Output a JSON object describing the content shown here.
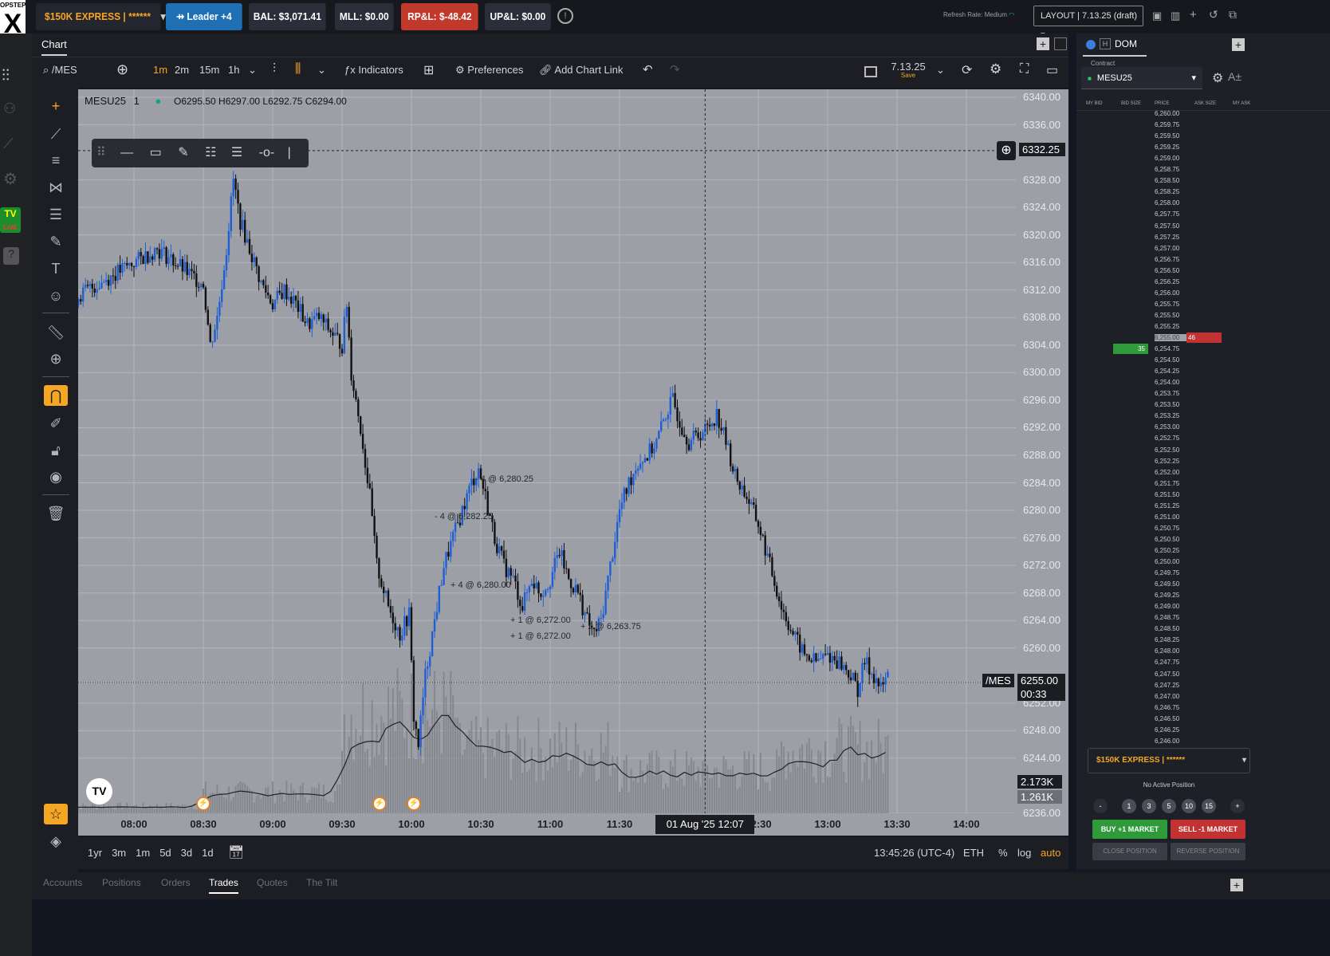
{
  "topbar": {
    "logo": "X",
    "logo_top": "OPSTEP",
    "account": "$150K EXPRESS | ******",
    "leader": "Leader +4",
    "bal": "BAL: $3,071.41",
    "mll": "MLL: $0.00",
    "rpl": "RP&L: $-48.42",
    "upl": "UP&L: $0.00",
    "refresh": "Refresh Rate: Medium",
    "layout": "LAYOUT | 7.13.25 (draft)"
  },
  "chart_header": {
    "tab": "Chart"
  },
  "toolbar": {
    "symbol": "/MES",
    "intervals": [
      "1m",
      "2m",
      "15m",
      "1h"
    ],
    "indicators": "Indicators",
    "preferences": "Preferences",
    "add_chart_link": "Add Chart Link",
    "layout_name": "7.13.25",
    "layout_state": "Save"
  },
  "legend": {
    "symbol": "MESU25",
    "interval": "1",
    "ohlc": "O6295.50  H6297.00  L6292.75  C6294.00"
  },
  "chart_data": {
    "type": "candlestick",
    "symbol": "MESU25",
    "interval": "1",
    "ylim": [
      6236,
      6340
    ],
    "y_ticks": [
      "6340.00",
      "6336.00",
      "6328.00",
      "6324.00",
      "6320.00",
      "6316.00",
      "6312.00",
      "6308.00",
      "6304.00",
      "6300.00",
      "6296.00",
      "6292.00",
      "6288.00",
      "6284.00",
      "6280.00",
      "6276.00",
      "6272.00",
      "6268.00",
      "6264.00",
      "6260.00",
      "6255.00",
      "6252.00",
      "6248.00",
      "6244.00",
      "6236.00"
    ],
    "x_ticks": [
      "08:00",
      "08:30",
      "09:00",
      "09:30",
      "10:00",
      "10:30",
      "11:00",
      "11:30",
      "12:30",
      "13:00",
      "13:30",
      "14:00"
    ],
    "x_minutes": [
      480,
      510,
      540,
      570,
      600,
      630,
      660,
      690,
      750,
      780,
      810,
      840
    ],
    "price_path": [
      [
        451,
        6310
      ],
      [
        460,
        6312
      ],
      [
        470,
        6314
      ],
      [
        480,
        6316
      ],
      [
        490,
        6318
      ],
      [
        498,
        6316
      ],
      [
        505,
        6314
      ],
      [
        510,
        6313
      ],
      [
        513,
        6304
      ],
      [
        516,
        6308
      ],
      [
        520,
        6318
      ],
      [
        523,
        6328
      ],
      [
        526,
        6322
      ],
      [
        530,
        6318
      ],
      [
        535,
        6313
      ],
      [
        540,
        6310
      ],
      [
        545,
        6312
      ],
      [
        550,
        6310
      ],
      [
        555,
        6307
      ],
      [
        560,
        6308
      ],
      [
        565,
        6306
      ],
      [
        570,
        6304
      ],
      [
        572,
        6310
      ],
      [
        574,
        6300
      ],
      [
        578,
        6292
      ],
      [
        582,
        6282
      ],
      [
        585,
        6272
      ],
      [
        590,
        6266
      ],
      [
        595,
        6262
      ],
      [
        599,
        6265
      ],
      [
        601,
        6250
      ],
      [
        603,
        6246
      ],
      [
        606,
        6256
      ],
      [
        610,
        6264
      ],
      [
        614,
        6272
      ],
      [
        618,
        6276
      ],
      [
        622,
        6280
      ],
      [
        626,
        6284
      ],
      [
        629,
        6286
      ],
      [
        632,
        6282
      ],
      [
        636,
        6276
      ],
      [
        640,
        6272
      ],
      [
        644,
        6270
      ],
      [
        648,
        6266
      ],
      [
        652,
        6270
      ],
      [
        656,
        6268
      ],
      [
        660,
        6270
      ],
      [
        664,
        6274
      ],
      [
        668,
        6270
      ],
      [
        672,
        6268
      ],
      [
        676,
        6264
      ],
      [
        679,
        6262
      ],
      [
        682,
        6264
      ],
      [
        686,
        6272
      ],
      [
        690,
        6280
      ],
      [
        694,
        6284
      ],
      [
        698,
        6287
      ],
      [
        702,
        6288
      ],
      [
        706,
        6290
      ],
      [
        710,
        6294
      ],
      [
        713,
        6296
      ],
      [
        716,
        6293
      ],
      [
        720,
        6290
      ],
      [
        724,
        6291
      ],
      [
        728,
        6292
      ],
      [
        732,
        6294
      ],
      [
        736,
        6290
      ],
      [
        740,
        6285
      ],
      [
        745,
        6282
      ],
      [
        750,
        6278
      ],
      [
        755,
        6272
      ],
      [
        760,
        6266
      ],
      [
        765,
        6262
      ],
      [
        770,
        6259
      ],
      [
        775,
        6258
      ],
      [
        780,
        6259
      ],
      [
        785,
        6258
      ],
      [
        790,
        6256
      ],
      [
        793,
        6254
      ],
      [
        796,
        6258
      ],
      [
        800,
        6256
      ],
      [
        803,
        6254
      ],
      [
        806,
        6256
      ]
    ],
    "last_price": "6255.00",
    "countdown": "00:33",
    "crosshair_price": "6332.25",
    "crosshair_time": "01 Aug '25  12:07",
    "volume_labels": [
      "2.173K",
      "1.261K"
    ],
    "annotations": [
      "- 4 @ 6,280.25",
      "- 4 @ 6,282.25",
      "+ 4 @ 6,280.00",
      "+ 1 @ 6,272.00",
      "+ 1 @ 6,272.00",
      "+ 2 @ 6,263.75"
    ],
    "price_badge_symbol": "/MES"
  },
  "bottombar": {
    "ranges": [
      "1yr",
      "3m",
      "1m",
      "5d",
      "3d",
      "1d"
    ],
    "clock": "13:45:26 (UTC-4)",
    "session": "ETH",
    "pct": "%",
    "log": "log",
    "auto": "auto"
  },
  "tabs": [
    "Accounts",
    "Positions",
    "Orders",
    "Trades",
    "Quotes",
    "The Tilt"
  ],
  "dom": {
    "title": "DOM",
    "contract_label": "Contract",
    "contract": "MESU25",
    "cols": [
      "MY BID",
      "BID SIZE",
      "PRICE",
      "ASK SIZE",
      "MY ASK"
    ],
    "prices": [
      "6,260.00",
      "6,259.75",
      "6,259.50",
      "6,259.25",
      "6,259.00",
      "6,258.75",
      "6,258.50",
      "6,258.25",
      "6,258.00",
      "6,257.75",
      "6,257.50",
      "6,257.25",
      "6,257.00",
      "6,256.75",
      "6,256.50",
      "6,256.25",
      "6,256.00",
      "6,255.75",
      "6,255.50",
      "6,255.25",
      "6,255.00",
      "6,254.75",
      "6,254.50",
      "6,254.25",
      "6,254.00",
      "6,253.75",
      "6,253.50",
      "6,253.25",
      "6,253.00",
      "6,252.75",
      "6,252.50",
      "6,252.25",
      "6,252.00",
      "6,251.75",
      "6,251.50",
      "6,251.25",
      "6,251.00",
      "6,250.75",
      "6,250.50",
      "6,250.25",
      "6,250.00",
      "6,249.75",
      "6,249.50",
      "6,249.25",
      "6,249.00",
      "6,248.75",
      "6,248.50",
      "6,248.25",
      "6,248.00",
      "6,247.75",
      "6,247.50",
      "6,247.25",
      "6,247.00",
      "6,246.75",
      "6,246.50",
      "6,246.25",
      "6,246.00"
    ],
    "ask_size": "46",
    "bid_size": "35",
    "account": "$150K EXPRESS | ******",
    "no_position": "No Active Position",
    "qty": [
      "-",
      "1",
      "3",
      "5",
      "10",
      "15",
      "+"
    ],
    "buy": "BUY +1 MARKET",
    "sell": "SELL -1 MARKET",
    "close": "CLOSE POSITION",
    "reverse": "REVERSE POSITION"
  },
  "colors": {
    "up": "#1f5fd6",
    "down": "#111111",
    "rpl_bg": "#c0392b",
    "leader_bg": "#1f6fb4",
    "buy_bg": "#2e9a3a",
    "sell_bg": "#c23232",
    "accent": "#f5a623"
  }
}
